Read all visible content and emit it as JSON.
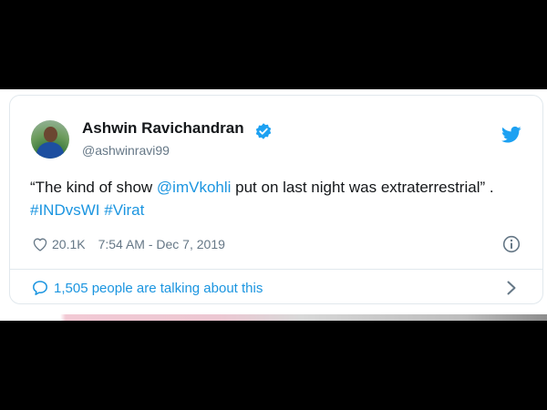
{
  "tweet": {
    "author_name": "Ashwin Ravichandran",
    "handle": "@ashwinravi99",
    "text": {
      "part1": "“The kind of show ",
      "mention": "@imVkohli",
      "part2": " put on last night was extraterrestrial” . ",
      "hashtag1": "#INDvsWI",
      "space": " ",
      "hashtag2": "#Virat"
    },
    "likes": "20.1K",
    "timestamp": "7:54 AM - Dec 7, 2019",
    "talking_about": "1,505 people are talking about this"
  },
  "icons": {
    "verified": "verified-badge-icon",
    "platform": "twitter-bird-icon",
    "like": "heart-icon",
    "info": "info-icon",
    "reply": "speech-bubble-icon",
    "chevron": "chevron-right-icon"
  },
  "colors": {
    "link": "#1b95e0",
    "text": "#14171a",
    "muted": "#657786",
    "border": "#e1e8ed"
  }
}
